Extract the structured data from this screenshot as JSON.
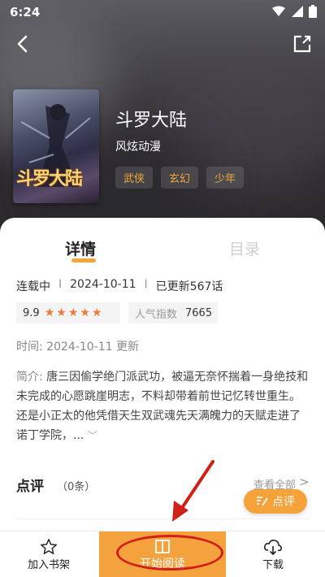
{
  "status": {
    "time": "6:24"
  },
  "book": {
    "title": "斗罗大陆",
    "author": "风炫动漫",
    "tags": [
      "武侠",
      "玄幻",
      "少年"
    ],
    "cover_title": "斗罗大陆"
  },
  "tabs": {
    "detail": "详情",
    "toc": "目录"
  },
  "meta": {
    "status": "连载中",
    "date": "2024-10-11",
    "updated": "已更新567话",
    "separator": "I"
  },
  "rating": {
    "score": "9.9",
    "stars": 5
  },
  "popularity": {
    "label": "人气指数",
    "value": "7665"
  },
  "time_row": {
    "label": "时间:",
    "value": "2024-10-11 更新"
  },
  "intro": {
    "label": "简介:",
    "text": "唐三因偷学绝门派武功，被逼无奈怀揣着一身绝技和未完成的心愿跳崖明志，不料却带着前世记忆转世重生。还是小正太的他凭借天生双武魂先天满魄力的天赋走进了诺丁学院，...",
    "more_icon": "chevron-down-icon"
  },
  "review": {
    "title": "点评",
    "count": "（0条）",
    "view_all": "查看全部",
    "comment_button": "点评"
  },
  "bottom": {
    "shelf": "加入书架",
    "read": "开始阅读",
    "download": "下载"
  },
  "colors": {
    "accent": "#f3a23e",
    "star": "#f07a3a",
    "tag_text": "#f0a63a",
    "annotation": "#d02018"
  }
}
